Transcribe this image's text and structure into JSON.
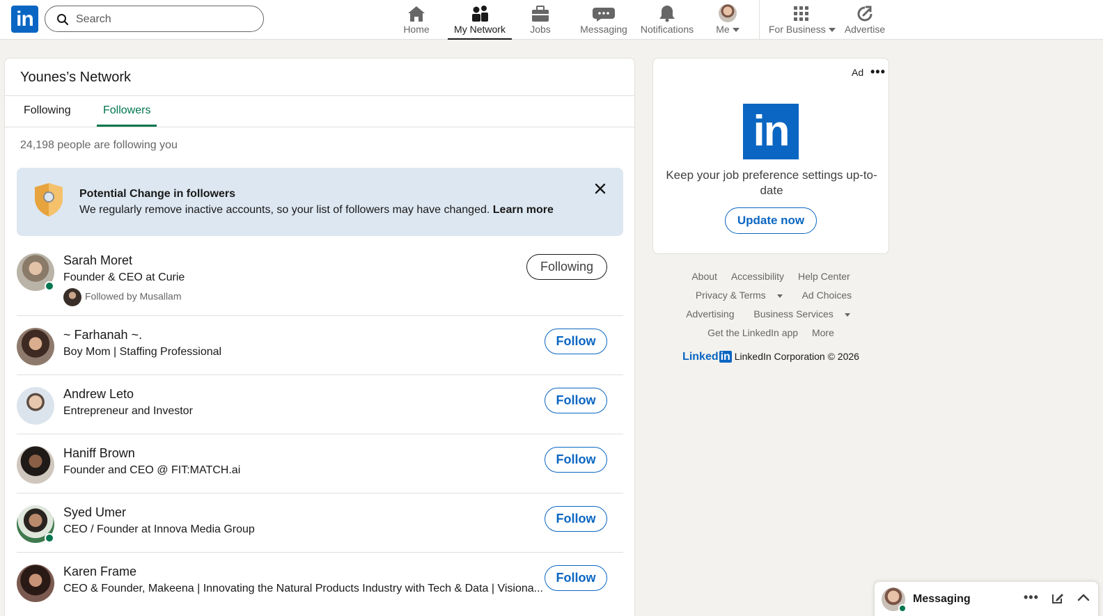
{
  "search": {
    "placeholder": "Search"
  },
  "nav": {
    "items": [
      {
        "label": "Home",
        "icon": "home-icon"
      },
      {
        "label": "My Network",
        "icon": "network-icon",
        "active": true
      },
      {
        "label": "Jobs",
        "icon": "briefcase-icon"
      },
      {
        "label": "Messaging",
        "icon": "chat-icon"
      },
      {
        "label": "Notifications",
        "icon": "bell-icon"
      },
      {
        "label": "Me",
        "icon": "avatar"
      },
      {
        "label": "For Business",
        "icon": "grid-icon"
      },
      {
        "label": "Advertise",
        "icon": "compass-icon"
      }
    ]
  },
  "network": {
    "title": "Younes’s Network",
    "tabs": [
      "Following",
      "Followers"
    ],
    "active_tab": "Followers",
    "count_text": "24,198 people are following you"
  },
  "notice": {
    "title": "Potential Change in followers",
    "text": "We regularly remove inactive accounts, so your list of followers may have changed.",
    "link": "Learn more"
  },
  "followers": [
    {
      "name": "Sarah Moret",
      "headline": "Founder & CEO at Curie",
      "mutual": "Followed by Musallam",
      "button": "Following",
      "online": true,
      "avatar_color": "#8a7a68"
    },
    {
      "name": "~ Farhanah ~.",
      "headline": "Boy Mom | Staffing Professional",
      "button": "Follow",
      "online": false,
      "avatar_color": "#6b4f3e"
    },
    {
      "name": "Andrew Leto",
      "headline": "Entrepreneur and Investor",
      "button": "Follow",
      "online": false,
      "avatar_color": "#c9b8a6"
    },
    {
      "name": "Haniff Brown",
      "headline": "Founder and CEO @ FIT:MATCH.ai",
      "button": "Follow",
      "online": false,
      "avatar_color": "#4a3a30"
    },
    {
      "name": "Syed Umer",
      "headline": "CEO / Founder at Innova Media Group",
      "button": "Follow",
      "online": true,
      "avatar_color": "#3f6b4d"
    },
    {
      "name": "Karen Frame",
      "headline": "CEO & Founder, Makeena | Innovating the Natural Products Industry with Tech & Data | Visiona...",
      "button": "Follow",
      "online": false,
      "avatar_color": "#5a3a32"
    }
  ],
  "ad": {
    "label": "Ad",
    "text": "Keep your job preference settings up-to-date",
    "button": "Update now"
  },
  "footer": {
    "links_row1": [
      "About",
      "Accessibility",
      "Help Center"
    ],
    "links_row2": [
      "Privacy & Terms",
      "Ad Choices"
    ],
    "links_row3": [
      "Advertising",
      "Business Services"
    ],
    "links_row4": [
      "Get the LinkedIn app",
      "More"
    ],
    "brand_word": "Linked",
    "brand_in": "in",
    "copyright": "LinkedIn Corporation © 2026"
  },
  "messaging_dock": {
    "label": "Messaging"
  },
  "colors": {
    "brand": "#0a66c2",
    "accent_green": "#01754f",
    "notice_bg": "#dde7f1"
  }
}
